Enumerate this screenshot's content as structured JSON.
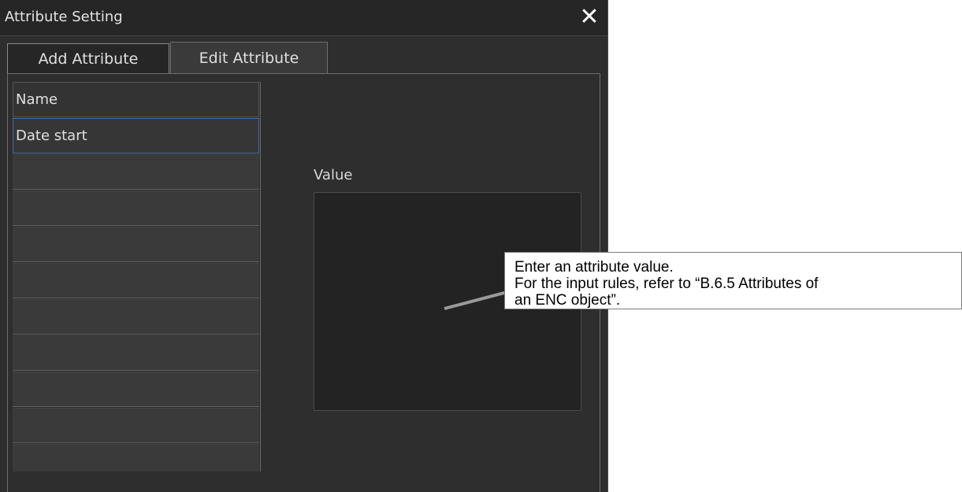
{
  "window": {
    "title": "Attribute Setting",
    "close_glyph": "✕"
  },
  "tabs": [
    {
      "label": "Add Attribute",
      "active": false
    },
    {
      "label": "Edit Attribute",
      "active": true
    }
  ],
  "attribute_list": {
    "header": "Name",
    "items": [
      {
        "label": "Date start",
        "selected": true
      },
      {
        "label": ""
      },
      {
        "label": ""
      },
      {
        "label": ""
      },
      {
        "label": ""
      },
      {
        "label": ""
      },
      {
        "label": ""
      },
      {
        "label": ""
      },
      {
        "label": ""
      },
      {
        "label": ""
      }
    ]
  },
  "value_field": {
    "label": "Value",
    "value": ""
  },
  "callout": {
    "line1": "Enter an attribute value.",
    "line2": "For the input rules, refer to “B.6.5 Attributes of",
    "line3": "an ENC object”."
  },
  "colors": {
    "dialog_bg": "#2e2e2e",
    "selection_border": "#3d6ea8",
    "leader_line": "#9a9a9a"
  }
}
